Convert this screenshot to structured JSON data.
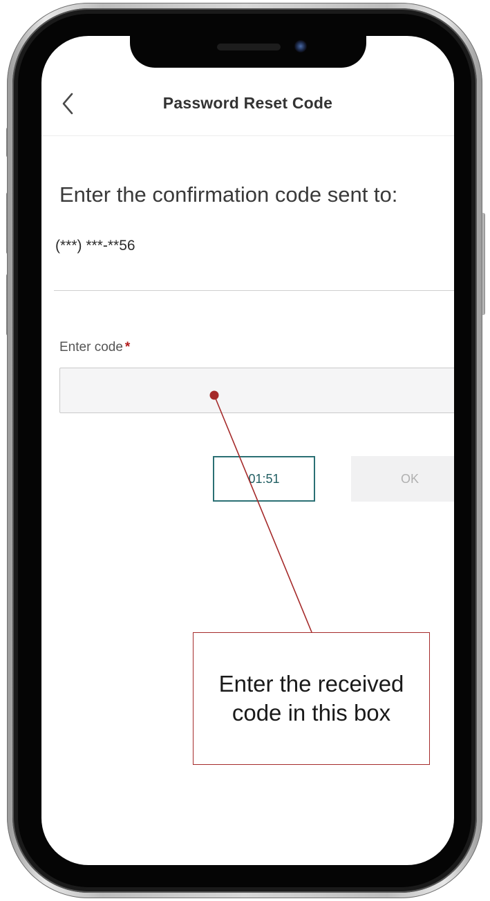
{
  "header": {
    "title": "Password Reset Code",
    "back_icon": "chevron-left-icon"
  },
  "main": {
    "heading": "Enter the confirmation code sent to:",
    "masked_phone": "(***) ***-**56",
    "code_field": {
      "label": "Enter code",
      "required_mark": "*",
      "value": "",
      "placeholder": ""
    },
    "timer_button_label": "01:51",
    "ok_button_label": "OK"
  },
  "annotation": {
    "text": "Enter the received code in this box",
    "color": "#a52a2a"
  },
  "colors": {
    "accent_teal": "#2a6f73",
    "required_red": "#b31b1b",
    "disabled_gray": "#b0b0b0"
  }
}
